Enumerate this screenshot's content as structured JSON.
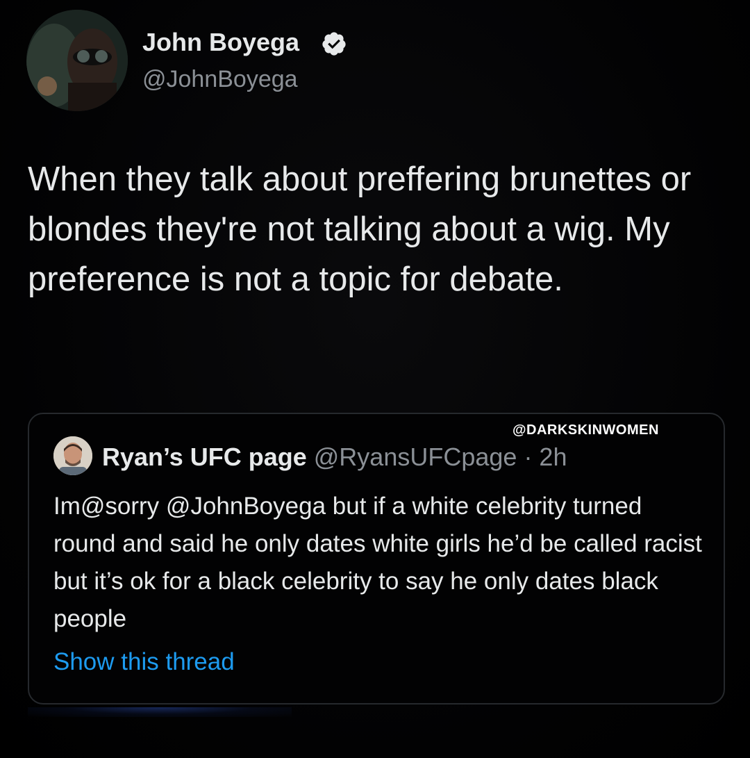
{
  "tweet": {
    "author": {
      "name": "John Boyega",
      "handle": "@JohnBoyega",
      "verified": true
    },
    "text": "When they talk about preffering brunettes or blondes they're not talking about a wig. My preference is not a topic for debate."
  },
  "quoted_tweet": {
    "author": {
      "name": "Ryan’s UFC page",
      "handle": "@RyansUFCpage",
      "time": "· 2h"
    },
    "text": "Im@sorry @JohnBoyega but if a white celebrity turned round and said he only dates white girls he’d be called racist but it’s ok for a black celebrity to say he only dates black people",
    "show_thread_label": "Show this thread"
  },
  "watermark": "@DARKSKINWOMEN",
  "colors": {
    "background": "#000000",
    "text_primary": "#e7e9ea",
    "text_secondary": "#8b9096",
    "link": "#1d9bf0",
    "verified_badge": "#e7e9ea",
    "card_border": "#26292d"
  }
}
